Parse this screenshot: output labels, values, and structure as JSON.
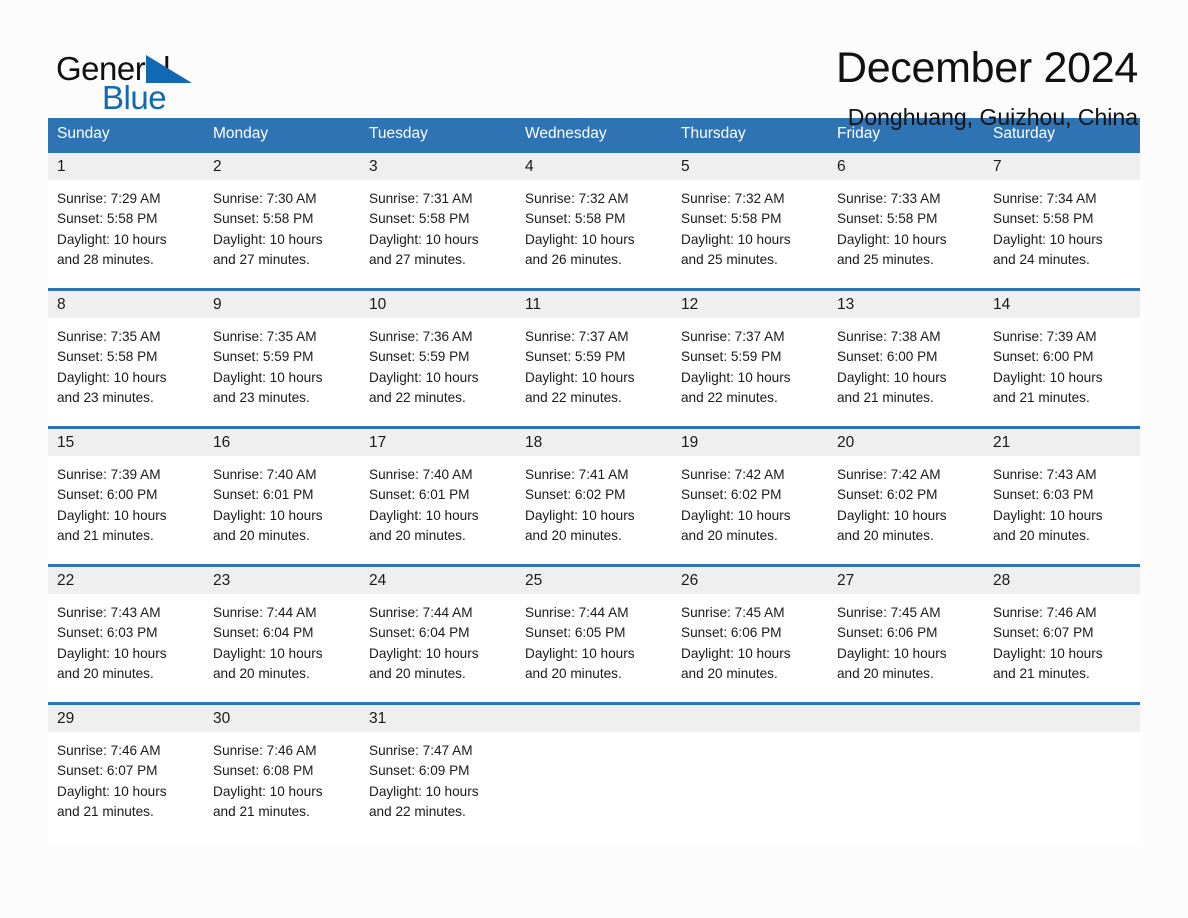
{
  "brand": {
    "name_part1": "General",
    "name_part2": "Blue",
    "triangle_color": "#1268b3"
  },
  "header": {
    "title": "December 2024",
    "subtitle": "Donghuang, Guizhou, China"
  },
  "theme": {
    "header_blue": "#2e74b5",
    "daynum_band": "#efefef",
    "page_background": "#fcfcfc"
  },
  "calendar": {
    "weekdays": [
      "Sunday",
      "Monday",
      "Tuesday",
      "Wednesday",
      "Thursday",
      "Friday",
      "Saturday"
    ],
    "weeks": [
      {
        "days": [
          {
            "date": "1",
            "sunrise": "Sunrise: 7:29 AM",
            "sunset": "Sunset: 5:58 PM",
            "daylight_1": "Daylight: 10 hours",
            "daylight_2": "and 28 minutes."
          },
          {
            "date": "2",
            "sunrise": "Sunrise: 7:30 AM",
            "sunset": "Sunset: 5:58 PM",
            "daylight_1": "Daylight: 10 hours",
            "daylight_2": "and 27 minutes."
          },
          {
            "date": "3",
            "sunrise": "Sunrise: 7:31 AM",
            "sunset": "Sunset: 5:58 PM",
            "daylight_1": "Daylight: 10 hours",
            "daylight_2": "and 27 minutes."
          },
          {
            "date": "4",
            "sunrise": "Sunrise: 7:32 AM",
            "sunset": "Sunset: 5:58 PM",
            "daylight_1": "Daylight: 10 hours",
            "daylight_2": "and 26 minutes."
          },
          {
            "date": "5",
            "sunrise": "Sunrise: 7:32 AM",
            "sunset": "Sunset: 5:58 PM",
            "daylight_1": "Daylight: 10 hours",
            "daylight_2": "and 25 minutes."
          },
          {
            "date": "6",
            "sunrise": "Sunrise: 7:33 AM",
            "sunset": "Sunset: 5:58 PM",
            "daylight_1": "Daylight: 10 hours",
            "daylight_2": "and 25 minutes."
          },
          {
            "date": "7",
            "sunrise": "Sunrise: 7:34 AM",
            "sunset": "Sunset: 5:58 PM",
            "daylight_1": "Daylight: 10 hours",
            "daylight_2": "and 24 minutes."
          }
        ]
      },
      {
        "days": [
          {
            "date": "8",
            "sunrise": "Sunrise: 7:35 AM",
            "sunset": "Sunset: 5:58 PM",
            "daylight_1": "Daylight: 10 hours",
            "daylight_2": "and 23 minutes."
          },
          {
            "date": "9",
            "sunrise": "Sunrise: 7:35 AM",
            "sunset": "Sunset: 5:59 PM",
            "daylight_1": "Daylight: 10 hours",
            "daylight_2": "and 23 minutes."
          },
          {
            "date": "10",
            "sunrise": "Sunrise: 7:36 AM",
            "sunset": "Sunset: 5:59 PM",
            "daylight_1": "Daylight: 10 hours",
            "daylight_2": "and 22 minutes."
          },
          {
            "date": "11",
            "sunrise": "Sunrise: 7:37 AM",
            "sunset": "Sunset: 5:59 PM",
            "daylight_1": "Daylight: 10 hours",
            "daylight_2": "and 22 minutes."
          },
          {
            "date": "12",
            "sunrise": "Sunrise: 7:37 AM",
            "sunset": "Sunset: 5:59 PM",
            "daylight_1": "Daylight: 10 hours",
            "daylight_2": "and 22 minutes."
          },
          {
            "date": "13",
            "sunrise": "Sunrise: 7:38 AM",
            "sunset": "Sunset: 6:00 PM",
            "daylight_1": "Daylight: 10 hours",
            "daylight_2": "and 21 minutes."
          },
          {
            "date": "14",
            "sunrise": "Sunrise: 7:39 AM",
            "sunset": "Sunset: 6:00 PM",
            "daylight_1": "Daylight: 10 hours",
            "daylight_2": "and 21 minutes."
          }
        ]
      },
      {
        "days": [
          {
            "date": "15",
            "sunrise": "Sunrise: 7:39 AM",
            "sunset": "Sunset: 6:00 PM",
            "daylight_1": "Daylight: 10 hours",
            "daylight_2": "and 21 minutes."
          },
          {
            "date": "16",
            "sunrise": "Sunrise: 7:40 AM",
            "sunset": "Sunset: 6:01 PM",
            "daylight_1": "Daylight: 10 hours",
            "daylight_2": "and 20 minutes."
          },
          {
            "date": "17",
            "sunrise": "Sunrise: 7:40 AM",
            "sunset": "Sunset: 6:01 PM",
            "daylight_1": "Daylight: 10 hours",
            "daylight_2": "and 20 minutes."
          },
          {
            "date": "18",
            "sunrise": "Sunrise: 7:41 AM",
            "sunset": "Sunset: 6:02 PM",
            "daylight_1": "Daylight: 10 hours",
            "daylight_2": "and 20 minutes."
          },
          {
            "date": "19",
            "sunrise": "Sunrise: 7:42 AM",
            "sunset": "Sunset: 6:02 PM",
            "daylight_1": "Daylight: 10 hours",
            "daylight_2": "and 20 minutes."
          },
          {
            "date": "20",
            "sunrise": "Sunrise: 7:42 AM",
            "sunset": "Sunset: 6:02 PM",
            "daylight_1": "Daylight: 10 hours",
            "daylight_2": "and 20 minutes."
          },
          {
            "date": "21",
            "sunrise": "Sunrise: 7:43 AM",
            "sunset": "Sunset: 6:03 PM",
            "daylight_1": "Daylight: 10 hours",
            "daylight_2": "and 20 minutes."
          }
        ]
      },
      {
        "days": [
          {
            "date": "22",
            "sunrise": "Sunrise: 7:43 AM",
            "sunset": "Sunset: 6:03 PM",
            "daylight_1": "Daylight: 10 hours",
            "daylight_2": "and 20 minutes."
          },
          {
            "date": "23",
            "sunrise": "Sunrise: 7:44 AM",
            "sunset": "Sunset: 6:04 PM",
            "daylight_1": "Daylight: 10 hours",
            "daylight_2": "and 20 minutes."
          },
          {
            "date": "24",
            "sunrise": "Sunrise: 7:44 AM",
            "sunset": "Sunset: 6:04 PM",
            "daylight_1": "Daylight: 10 hours",
            "daylight_2": "and 20 minutes."
          },
          {
            "date": "25",
            "sunrise": "Sunrise: 7:44 AM",
            "sunset": "Sunset: 6:05 PM",
            "daylight_1": "Daylight: 10 hours",
            "daylight_2": "and 20 minutes."
          },
          {
            "date": "26",
            "sunrise": "Sunrise: 7:45 AM",
            "sunset": "Sunset: 6:06 PM",
            "daylight_1": "Daylight: 10 hours",
            "daylight_2": "and 20 minutes."
          },
          {
            "date": "27",
            "sunrise": "Sunrise: 7:45 AM",
            "sunset": "Sunset: 6:06 PM",
            "daylight_1": "Daylight: 10 hours",
            "daylight_2": "and 20 minutes."
          },
          {
            "date": "28",
            "sunrise": "Sunrise: 7:46 AM",
            "sunset": "Sunset: 6:07 PM",
            "daylight_1": "Daylight: 10 hours",
            "daylight_2": "and 21 minutes."
          }
        ]
      },
      {
        "days": [
          {
            "date": "29",
            "sunrise": "Sunrise: 7:46 AM",
            "sunset": "Sunset: 6:07 PM",
            "daylight_1": "Daylight: 10 hours",
            "daylight_2": "and 21 minutes."
          },
          {
            "date": "30",
            "sunrise": "Sunrise: 7:46 AM",
            "sunset": "Sunset: 6:08 PM",
            "daylight_1": "Daylight: 10 hours",
            "daylight_2": "and 21 minutes."
          },
          {
            "date": "31",
            "sunrise": "Sunrise: 7:47 AM",
            "sunset": "Sunset: 6:09 PM",
            "daylight_1": "Daylight: 10 hours",
            "daylight_2": "and 22 minutes."
          },
          {
            "date": "",
            "sunrise": "",
            "sunset": "",
            "daylight_1": "",
            "daylight_2": ""
          },
          {
            "date": "",
            "sunrise": "",
            "sunset": "",
            "daylight_1": "",
            "daylight_2": ""
          },
          {
            "date": "",
            "sunrise": "",
            "sunset": "",
            "daylight_1": "",
            "daylight_2": ""
          },
          {
            "date": "",
            "sunrise": "",
            "sunset": "",
            "daylight_1": "",
            "daylight_2": ""
          }
        ]
      }
    ]
  }
}
